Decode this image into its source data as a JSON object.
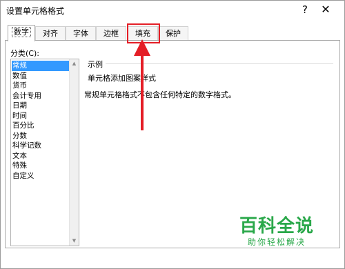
{
  "window": {
    "title": "设置单元格格式",
    "help_glyph": "?",
    "close_glyph": "✕"
  },
  "tabs": [
    {
      "label": "数字",
      "active": true
    },
    {
      "label": "对齐",
      "active": false
    },
    {
      "label": "字体",
      "active": false
    },
    {
      "label": "边框",
      "active": false
    },
    {
      "label": "填充",
      "active": false,
      "highlighted": true
    },
    {
      "label": "保护",
      "active": false
    }
  ],
  "category": {
    "label": "分类(C):",
    "items": [
      "常规",
      "数值",
      "货币",
      "会计专用",
      "日期",
      "时间",
      "百分比",
      "分数",
      "科学记数",
      "文本",
      "特殊",
      "自定义"
    ],
    "selected": "常规"
  },
  "sample": {
    "label": "示例",
    "value": "单元格添加图案样式"
  },
  "description": "常规单元格格式不包含任何特定的数字格式。",
  "annotation": {
    "color": "#e41e26"
  },
  "watermark": {
    "logo": "百科全说",
    "subtitle": "助你轻松解决",
    "color": "#2aa84a"
  }
}
